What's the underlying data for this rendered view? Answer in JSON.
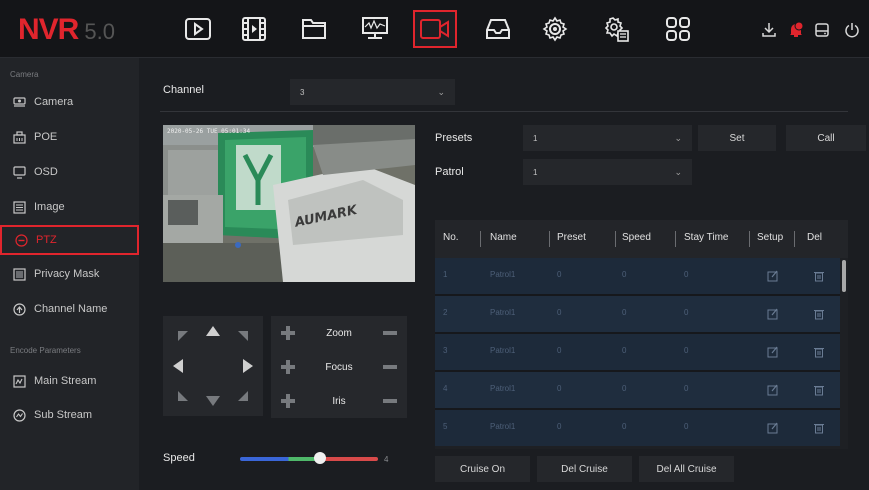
{
  "brand": {
    "logo": "NVR",
    "version": "5.0"
  },
  "topnav": [
    "playback-icon",
    "video-clip-icon",
    "folder-icon",
    "network-monitor-icon",
    "camera-settings-icon",
    "storage-icon",
    "settings-gear-icon",
    "system-config-icon",
    "grid-apps-icon"
  ],
  "sys_icons": [
    "download-icon",
    "alarm-bell-icon",
    "disk-icon",
    "power-icon"
  ],
  "accent": "#e0252d",
  "sidebar": {
    "section_camera": "Camera",
    "section_encode": "Encode Parameters",
    "items": [
      {
        "label": "Camera",
        "icon": "camera-icon"
      },
      {
        "label": "POE",
        "icon": "poe-icon"
      },
      {
        "label": "OSD",
        "icon": "monitor-icon"
      },
      {
        "label": "Image",
        "icon": "image-icon"
      },
      {
        "label": "PTZ",
        "icon": "ptz-icon"
      },
      {
        "label": "Privacy Mask",
        "icon": "mask-icon"
      },
      {
        "label": "Channel Name",
        "icon": "channel-icon"
      },
      {
        "label": "Main Stream",
        "icon": "main-stream-icon"
      },
      {
        "label": "Sub Stream",
        "icon": "sub-stream-icon"
      }
    ]
  },
  "main": {
    "channel_label": "Channel",
    "channel_value": "3",
    "presets_label": "Presets",
    "presets_value": "1",
    "patrol_label": "Patrol",
    "patrol_value": "1",
    "set_label": "Set",
    "call_label": "Call",
    "video_timestamp": "2020-05-26 TUE 05:01:34",
    "video_sign_text": "AUMARK",
    "zoom_label": "Zoom",
    "focus_label": "Focus",
    "iris_label": "Iris",
    "speed_label": "Speed",
    "speed_value": "4",
    "cruise_on_label": "Cruise On",
    "del_cruise_label": "Del Cruise",
    "del_all_cruise_label": "Del All Cruise"
  },
  "table": {
    "headers": [
      "No.",
      "Name",
      "Preset",
      "Speed",
      "Stay Time",
      "Setup",
      "Del"
    ],
    "rows": [
      {
        "no": "1",
        "name": "Patrol1",
        "preset": "0",
        "speed": "0",
        "stay": "0"
      },
      {
        "no": "2",
        "name": "Patrol1",
        "preset": "0",
        "speed": "0",
        "stay": "0"
      },
      {
        "no": "3",
        "name": "Patrol1",
        "preset": "0",
        "speed": "0",
        "stay": "0"
      },
      {
        "no": "4",
        "name": "Patrol1",
        "preset": "0",
        "speed": "0",
        "stay": "0"
      },
      {
        "no": "5",
        "name": "Patrol1",
        "preset": "0",
        "speed": "0",
        "stay": "0"
      }
    ]
  }
}
